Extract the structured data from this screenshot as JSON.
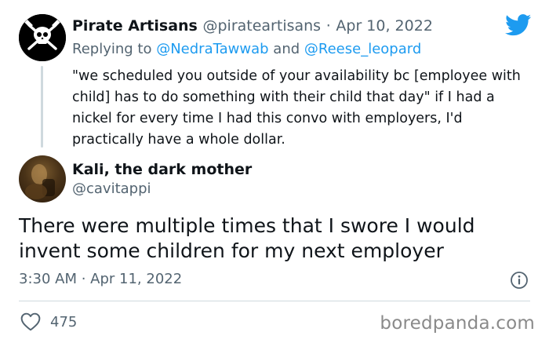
{
  "parent_tweet": {
    "display_name": "Pirate Artisans",
    "handle": "@pirateartisans",
    "separator": "·",
    "date": "Apr 10, 2022",
    "replying_prefix": "Replying to",
    "reply_to_1": "@NedraTawwab",
    "reply_conjunction": "and",
    "reply_to_2": "@Reese_leopard",
    "text": "\"we scheduled you outside of your availability bc [employee with child] has to do something with their child that day\" if I had a nickel for every time I had this convo with employers, I'd practically have a whole dollar."
  },
  "main_tweet": {
    "display_name": "Kali, the dark mother",
    "handle": "@cavitappi",
    "text": "There were multiple times that I swore I would invent some children for my next employer",
    "timestamp": "3:30 AM · Apr 11, 2022",
    "likes": "475"
  },
  "watermark": "boredpanda.com",
  "colors": {
    "twitter_blue": "#1d9bf0",
    "secondary_text": "#536471",
    "divider": "#cfd9de"
  },
  "icons": {
    "brand": "twitter-bird-icon",
    "info": "info-icon",
    "like": "heart-icon",
    "avatar_parent": "skull-crossbones-avatar"
  }
}
